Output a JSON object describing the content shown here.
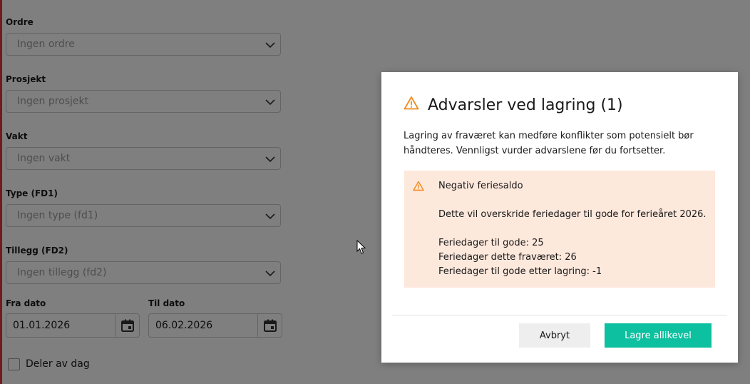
{
  "form": {
    "order": {
      "label": "Ordre",
      "placeholder": "Ingen ordre"
    },
    "project": {
      "label": "Prosjekt",
      "placeholder": "Ingen prosjekt"
    },
    "shift": {
      "label": "Vakt",
      "placeholder": "Ingen vakt"
    },
    "type": {
      "label": "Type (FD1)",
      "placeholder": "Ingen type (fd1)"
    },
    "addition": {
      "label": "Tillegg (FD2)",
      "placeholder": "Ingen tillegg (fd2)"
    },
    "from_date": {
      "label": "Fra dato",
      "value": "01.01.2026"
    },
    "to_date": {
      "label": "Til dato",
      "value": "06.02.2026"
    },
    "part_of_day": {
      "label": "Deler av dag",
      "checked": false
    }
  },
  "dialog": {
    "title": "Advarsler ved lagring (1)",
    "description": "Lagring av fraværet kan medføre konflikter som potensielt bør håndteres. Vennligst vurder advarslene før du fortsetter.",
    "warnings": [
      {
        "title": "Negativ feriesaldo",
        "message": "Dette vil overskride feriedager til gode for ferieåret 2026.",
        "details": [
          "Feriedager til gode: 25",
          "Feriedager dette fraværet: 26",
          "Feriedager til gode etter lagring: -1"
        ]
      }
    ],
    "cancel_label": "Avbryt",
    "confirm_label": "Lagre allikevel"
  },
  "colors": {
    "accent": "#0cc0a0",
    "warning_icon": "#f08a1c",
    "warning_bg": "#fde8dc",
    "left_accent": "#e8343a"
  },
  "icons": {
    "select": "chevron-down-icon",
    "date": "calendar-icon",
    "warning": "warning-triangle-icon",
    "cursor": "mouse-cursor-icon"
  }
}
